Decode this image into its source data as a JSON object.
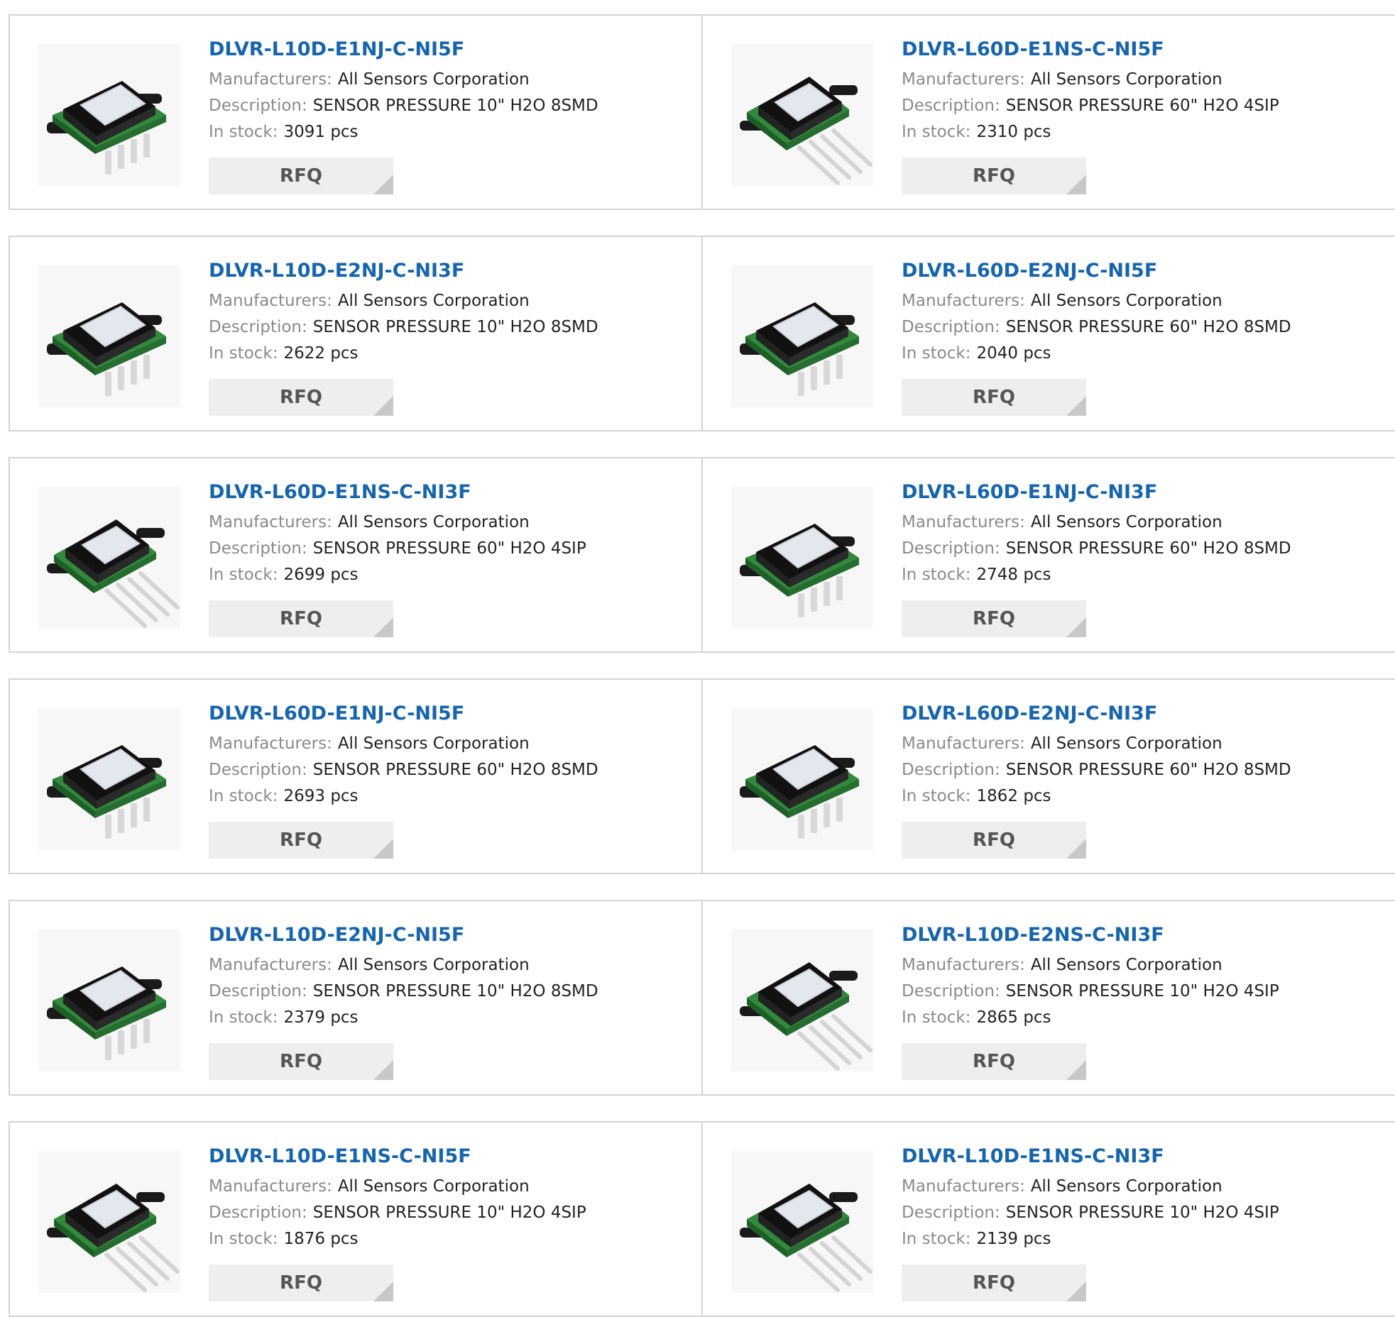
{
  "labels": {
    "manufacturers": "Manufacturers:",
    "description": "Description:",
    "in_stock": "In stock:",
    "rfq": "RFQ"
  },
  "products": [
    {
      "part": "DLVR-L10D-E1NJ-C-NI5F",
      "manufacturer": "All Sensors Corporation",
      "description": "SENSOR PRESSURE 10\" H2O 8SMD",
      "stock": "3091 pcs",
      "image": "smd"
    },
    {
      "part": "DLVR-L60D-E1NS-C-NI5F",
      "manufacturer": "All Sensors Corporation",
      "description": "SENSOR PRESSURE 60\" H2O 4SIP",
      "stock": "2310 pcs",
      "image": "sip"
    },
    {
      "part": "DLVR-L10D-E2NJ-C-NI3F",
      "manufacturer": "All Sensors Corporation",
      "description": "SENSOR PRESSURE 10\" H2O 8SMD",
      "stock": "2622 pcs",
      "image": "smd"
    },
    {
      "part": "DLVR-L60D-E2NJ-C-NI5F",
      "manufacturer": "All Sensors Corporation",
      "description": "SENSOR PRESSURE 60\" H2O 8SMD",
      "stock": "2040 pcs",
      "image": "smd"
    },
    {
      "part": "DLVR-L60D-E1NS-C-NI3F",
      "manufacturer": "All Sensors Corporation",
      "description": "SENSOR PRESSURE 60\" H2O 4SIP",
      "stock": "2699 pcs",
      "image": "sip"
    },
    {
      "part": "DLVR-L60D-E1NJ-C-NI3F",
      "manufacturer": "All Sensors Corporation",
      "description": "SENSOR PRESSURE 60\" H2O 8SMD",
      "stock": "2748 pcs",
      "image": "smd"
    },
    {
      "part": "DLVR-L60D-E1NJ-C-NI5F",
      "manufacturer": "All Sensors Corporation",
      "description": "SENSOR PRESSURE 60\" H2O 8SMD",
      "stock": "2693 pcs",
      "image": "smd"
    },
    {
      "part": "DLVR-L60D-E2NJ-C-NI3F",
      "manufacturer": "All Sensors Corporation",
      "description": "SENSOR PRESSURE 60\" H2O 8SMD",
      "stock": "1862 pcs",
      "image": "smd"
    },
    {
      "part": "DLVR-L10D-E2NJ-C-NI5F",
      "manufacturer": "All Sensors Corporation",
      "description": "SENSOR PRESSURE 10\" H2O 8SMD",
      "stock": "2379 pcs",
      "image": "smd"
    },
    {
      "part": "DLVR-L10D-E2NS-C-NI3F",
      "manufacturer": "All Sensors Corporation",
      "description": "SENSOR PRESSURE 10\" H2O 4SIP",
      "stock": "2865 pcs",
      "image": "sip"
    },
    {
      "part": "DLVR-L10D-E1NS-C-NI5F",
      "manufacturer": "All Sensors Corporation",
      "description": "SENSOR PRESSURE 10\" H2O 4SIP",
      "stock": "1876 pcs",
      "image": "sip"
    },
    {
      "part": "DLVR-L10D-E1NS-C-NI3F",
      "manufacturer": "All Sensors Corporation",
      "description": "SENSOR PRESSURE 10\" H2O 4SIP",
      "stock": "2139 pcs",
      "image": "sip"
    }
  ]
}
